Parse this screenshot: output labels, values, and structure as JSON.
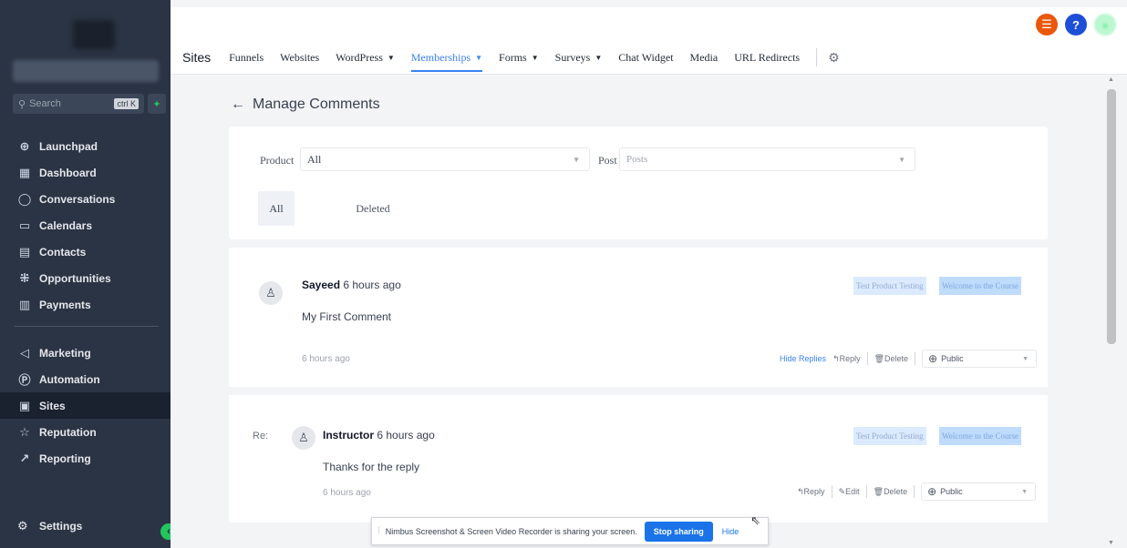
{
  "sidebar": {
    "search_placeholder": "Search",
    "search_shortcut": "ctrl K",
    "items_top": [
      {
        "label": "Launchpad",
        "icon": "launchpad-icon",
        "glyph": "⊕"
      },
      {
        "label": "Dashboard",
        "icon": "dashboard-icon",
        "glyph": "▦"
      },
      {
        "label": "Conversations",
        "icon": "chat-icon",
        "glyph": "◯"
      },
      {
        "label": "Calendars",
        "icon": "calendar-icon",
        "glyph": "▭"
      },
      {
        "label": "Contacts",
        "icon": "contacts-icon",
        "glyph": "▤"
      },
      {
        "label": "Opportunities",
        "icon": "opportunities-icon",
        "glyph": "⁜"
      },
      {
        "label": "Payments",
        "icon": "payments-icon",
        "glyph": "▥"
      }
    ],
    "items_bottom": [
      {
        "label": "Marketing",
        "icon": "send-icon",
        "glyph": "◁"
      },
      {
        "label": "Automation",
        "icon": "automation-icon",
        "glyph": "Ⓟ"
      },
      {
        "label": "Sites",
        "icon": "sites-icon",
        "glyph": "▣",
        "active": true
      },
      {
        "label": "Reputation",
        "icon": "star-icon",
        "glyph": "☆"
      },
      {
        "label": "Reporting",
        "icon": "trend-icon",
        "glyph": "↗"
      }
    ],
    "settings_label": "Settings"
  },
  "topnav": {
    "brand": "Sites",
    "links": [
      {
        "label": "Funnels",
        "dropdown": false
      },
      {
        "label": "Websites",
        "dropdown": false
      },
      {
        "label": "WordPress",
        "dropdown": true
      },
      {
        "label": "Memberships",
        "dropdown": true,
        "active": true
      },
      {
        "label": "Forms",
        "dropdown": true
      },
      {
        "label": "Surveys",
        "dropdown": true
      },
      {
        "label": "Chat Widget",
        "dropdown": false
      },
      {
        "label": "Media",
        "dropdown": false
      },
      {
        "label": "URL Redirects",
        "dropdown": false
      }
    ]
  },
  "page": {
    "title": "Manage Comments",
    "product_label": "Product",
    "product_value": "All",
    "post_label": "Post",
    "post_placeholder": "Posts",
    "tabs": [
      "All",
      "Deleted"
    ]
  },
  "comments": [
    {
      "author": "Sayeed",
      "time": "6 hours ago",
      "text": "My First Comment",
      "footer_time": "6 hours ago",
      "tags": [
        "Test Product Testing",
        "Welcome to the Course"
      ],
      "actions": {
        "hide_replies": "Hide Replies",
        "reply": "Reply",
        "delete": "Delete"
      },
      "visibility": "Public"
    },
    {
      "re": "Re:",
      "author": "Instructor",
      "time": "6 hours ago",
      "text": "Thanks for the reply",
      "footer_time": "6 hours ago",
      "tags": [
        "Test Product Testing",
        "Welcome to the Course"
      ],
      "actions": {
        "reply": "Reply",
        "edit": "Edit",
        "delete": "Delete"
      },
      "visibility": "Public"
    }
  ],
  "share_bar": {
    "message": "Nimbus Screenshot & Screen Video Recorder is sharing your screen.",
    "stop_label": "Stop sharing",
    "hide_label": "Hide"
  },
  "colors": {
    "sidebar_bg": "#2b3444",
    "accent": "#3b82f6",
    "success": "#22c55e"
  }
}
